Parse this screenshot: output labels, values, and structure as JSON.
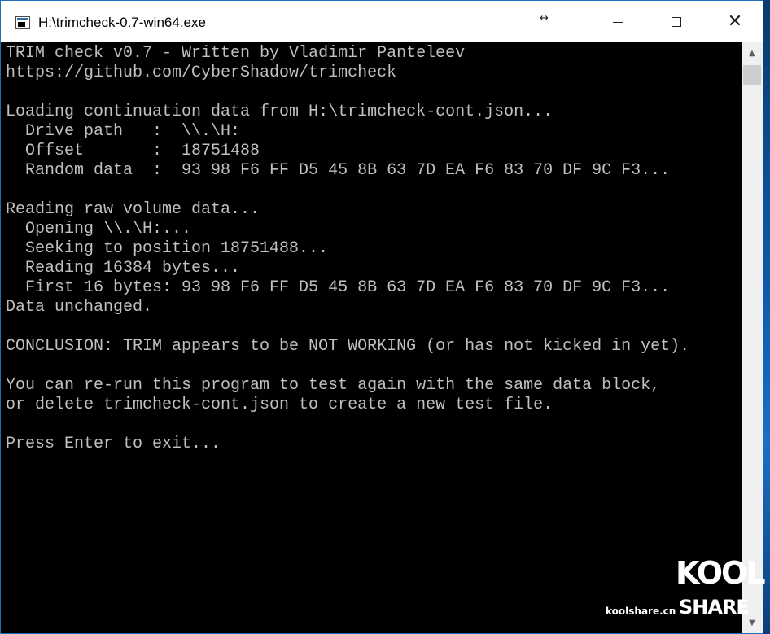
{
  "window": {
    "title": "H:\\trimcheck-0.7-win64.exe",
    "resize_hint": "↔",
    "controls": {
      "minimize": "minimize",
      "maximize": "maximize",
      "close": "✕"
    }
  },
  "console": {
    "lines": [
      "TRIM check v0.7 - Written by Vladimir Panteleev",
      "https://github.com/CyberShadow/trimcheck",
      "",
      "Loading continuation data from H:\\trimcheck-cont.json...",
      "  Drive path   :  \\\\.\\H:",
      "  Offset       :  18751488",
      "  Random data  :  93 98 F6 FF D5 45 8B 63 7D EA F6 83 70 DF 9C F3...",
      "",
      "Reading raw volume data...",
      "  Opening \\\\.\\H:...",
      "  Seeking to position 18751488...",
      "  Reading 16384 bytes...",
      "  First 16 bytes: 93 98 F6 FF D5 45 8B 63 7D EA F6 83 70 DF 9C F3...",
      "Data unchanged.",
      "",
      "CONCLUSION: TRIM appears to be NOT WORKING (or has not kicked in yet).",
      "",
      "You can re-run this program to test again with the same data block,",
      "or delete trimcheck-cont.json to create a new test file.",
      "",
      "Press Enter to exit..."
    ],
    "text_color": "#c0c0c0",
    "background": "#000000"
  },
  "scrollbar": {
    "up_arrow": "▲",
    "down_arrow": "▼"
  },
  "watermark": {
    "site": "koolshare.cn",
    "logo_top": "KOOL",
    "logo_bottom": "SHARE"
  }
}
